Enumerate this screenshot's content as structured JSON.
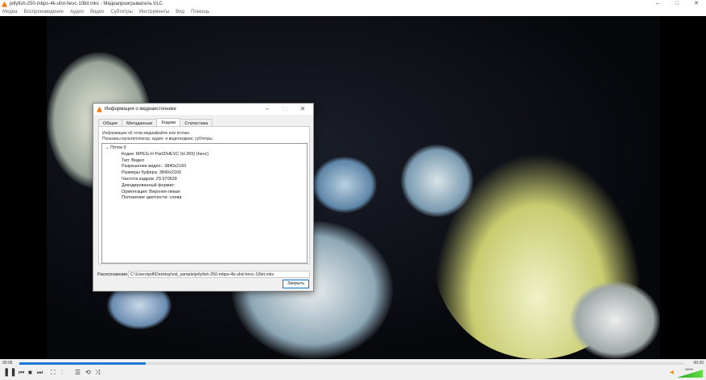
{
  "window": {
    "title": "jellyfish-250-mbps-4k-uhd-hevc-10bit.mkv - Медиапроигрыватель VLC",
    "controls": [
      "–",
      "□",
      "✕"
    ]
  },
  "menu": [
    "Медиа",
    "Воспроизведение",
    "Аудио",
    "Видео",
    "Субтитры",
    "Инструменты",
    "Вид",
    "Помощь"
  ],
  "dialog": {
    "title": "Информация о медиаисточнике",
    "tabs": [
      "Общие",
      "Метаданные",
      "Кодеки",
      "Статистика"
    ],
    "active_tab": "Кодеки",
    "description": [
      "Информация об этом медиафайле или потоке.",
      "Показаны мультиплексор, аудио- и видеокодеки, субтитры."
    ],
    "stream": "Поток 0",
    "details": [
      "Кодек: MPEG-H Part2/HEVC (H.265) (hevc)",
      "Тип: Видео",
      "Разрешение видео.: 3840x2160",
      "Размеры буфера: 3840x2160",
      "Частота кадров: 29.970628",
      "Декодированный формат:",
      "Ориентация: Верхняя-левая",
      "Положение цветности: слева"
    ],
    "location_label": "Расположение:",
    "location": "C:\\Users\\pdf\\Desktop\\vid_sample\\jellyfish-250-mbps-4k-uhd-hevc-10bit.mkv",
    "close_label": "Закрыть"
  },
  "player": {
    "elapsed": "00:05",
    "total": "00:30",
    "progress": 0.19,
    "volume": "100%"
  }
}
